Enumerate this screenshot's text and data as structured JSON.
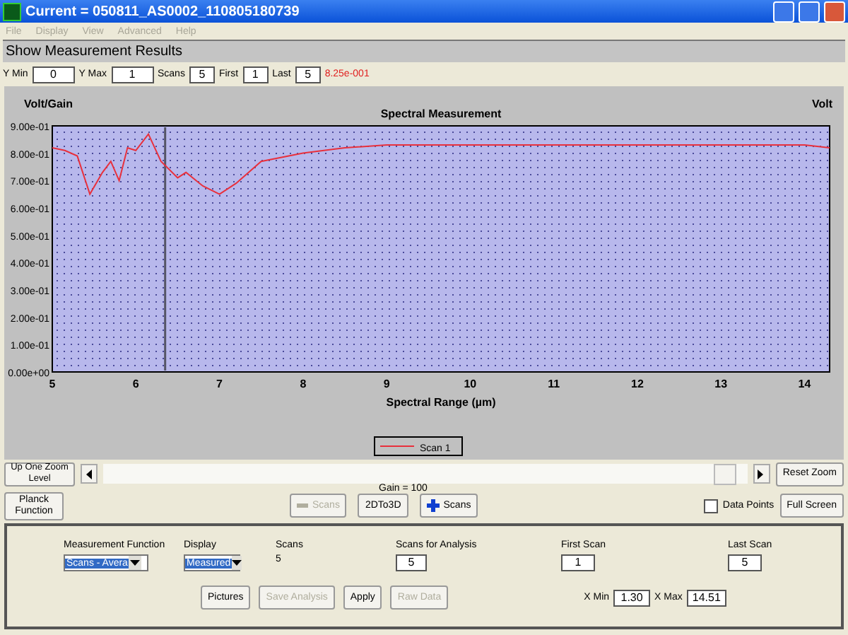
{
  "window": {
    "title": "Current = 050811_AS0002_110805180739"
  },
  "menu": [
    {
      "label": "File",
      "disabled": true
    },
    {
      "label": "Display",
      "disabled": true
    },
    {
      "label": "View",
      "disabled": true
    },
    {
      "label": "Advanced",
      "disabled": true
    },
    {
      "label": "Help",
      "disabled": true
    }
  ],
  "header": "Show Measurement Results",
  "toolbar": {
    "fields": [
      {
        "label": "Y Min",
        "value": "0"
      },
      {
        "label": "Y Max",
        "value": "1"
      },
      {
        "label": "Scans",
        "value": "5"
      },
      {
        "label": "First",
        "value": "1"
      },
      {
        "label": "Last",
        "value": "5"
      }
    ],
    "reading": "8.25e-001"
  },
  "chart": {
    "right_axis_label": "Volt",
    "chart_data": {
      "type": "line",
      "title": "Spectral Measurement",
      "xlabel": "Spectral Range (µm)",
      "ylabel": "Volt/Gain",
      "xlim": [
        5,
        14.3
      ],
      "ylim": [
        0,
        0.9
      ],
      "xticks": [
        5,
        6,
        7,
        8,
        9,
        10,
        11,
        12,
        13,
        14
      ],
      "yticks": [
        {
          "value": 0,
          "label": "0.00e+00"
        },
        {
          "value": 0.1,
          "label": "1.00e-01"
        },
        {
          "value": 0.2,
          "label": "2.00e-01"
        },
        {
          "value": 0.3,
          "label": "3.00e-01"
        },
        {
          "value": 0.4,
          "label": "4.00e-01"
        },
        {
          "value": 0.5,
          "label": "5.00e-01"
        },
        {
          "value": 0.6,
          "label": "6.00e-01"
        },
        {
          "value": 0.7,
          "label": "7.00e-01"
        },
        {
          "value": 0.8,
          "label": "8.00e-01"
        },
        {
          "value": 0.9,
          "label": "9.00e-01"
        }
      ],
      "ref_lines": [
        {
          "axis": "x",
          "value": 6.35,
          "color": "#555566"
        }
      ],
      "x": [
        5,
        5.15,
        5.3,
        5.45,
        5.6,
        5.7,
        5.8,
        5.9,
        6,
        6.15,
        6.3,
        6.5,
        6.6,
        6.8,
        7,
        7.2,
        7.5,
        8,
        8.5,
        9,
        10,
        11,
        12,
        13,
        14,
        14.3
      ],
      "series": [
        {
          "name": "Scan 1",
          "color": "#e8303c",
          "values": [
            0.82,
            0.81,
            0.79,
            0.65,
            0.73,
            0.77,
            0.7,
            0.82,
            0.81,
            0.87,
            0.77,
            0.71,
            0.73,
            0.68,
            0.65,
            0.69,
            0.77,
            0.8,
            0.82,
            0.83,
            0.83,
            0.83,
            0.83,
            0.83,
            0.83,
            0.82
          ]
        }
      ]
    }
  },
  "zoom_bar": {
    "up_button": "Up One Zoom Level",
    "reset_button": "Reset Zoom"
  },
  "actions": {
    "gain": "Gain = 100",
    "planck_button": {
      "label": "Planck Function",
      "disabled": false
    },
    "scans_remove_button": {
      "label": "Scans",
      "disabled": true
    },
    "convert_button": {
      "label": "2DTo3D",
      "disabled": false
    },
    "scans_add_button": {
      "label": "Scans",
      "disabled": false
    },
    "data_points": {
      "label": "Data Points",
      "checked": false
    },
    "full_screen_button": {
      "label": "Full Screen",
      "disabled": false
    }
  },
  "analysis": {
    "measurement_function": {
      "label": "Measurement Function",
      "value": "Scans - Avera"
    },
    "display": {
      "label": "Display",
      "value": "Measured"
    },
    "scans": {
      "label": "Scans",
      "value": "5"
    },
    "scans_for_analysis": {
      "label": "Scans for Analysis",
      "value": "5"
    },
    "first_scan": {
      "label": "First Scan",
      "value": "1"
    },
    "last_scan": {
      "label": "Last Scan",
      "value": "5"
    },
    "buttons": [
      {
        "label": "Pictures",
        "disabled": false
      },
      {
        "label": "Save Analysis",
        "disabled": true
      },
      {
        "label": "Apply",
        "disabled": false
      },
      {
        "label": "Raw Data",
        "disabled": true
      }
    ],
    "x_min": {
      "label": "X Min",
      "value": "1.30"
    },
    "x_max": {
      "label": "X Max",
      "value": "14.51"
    }
  }
}
